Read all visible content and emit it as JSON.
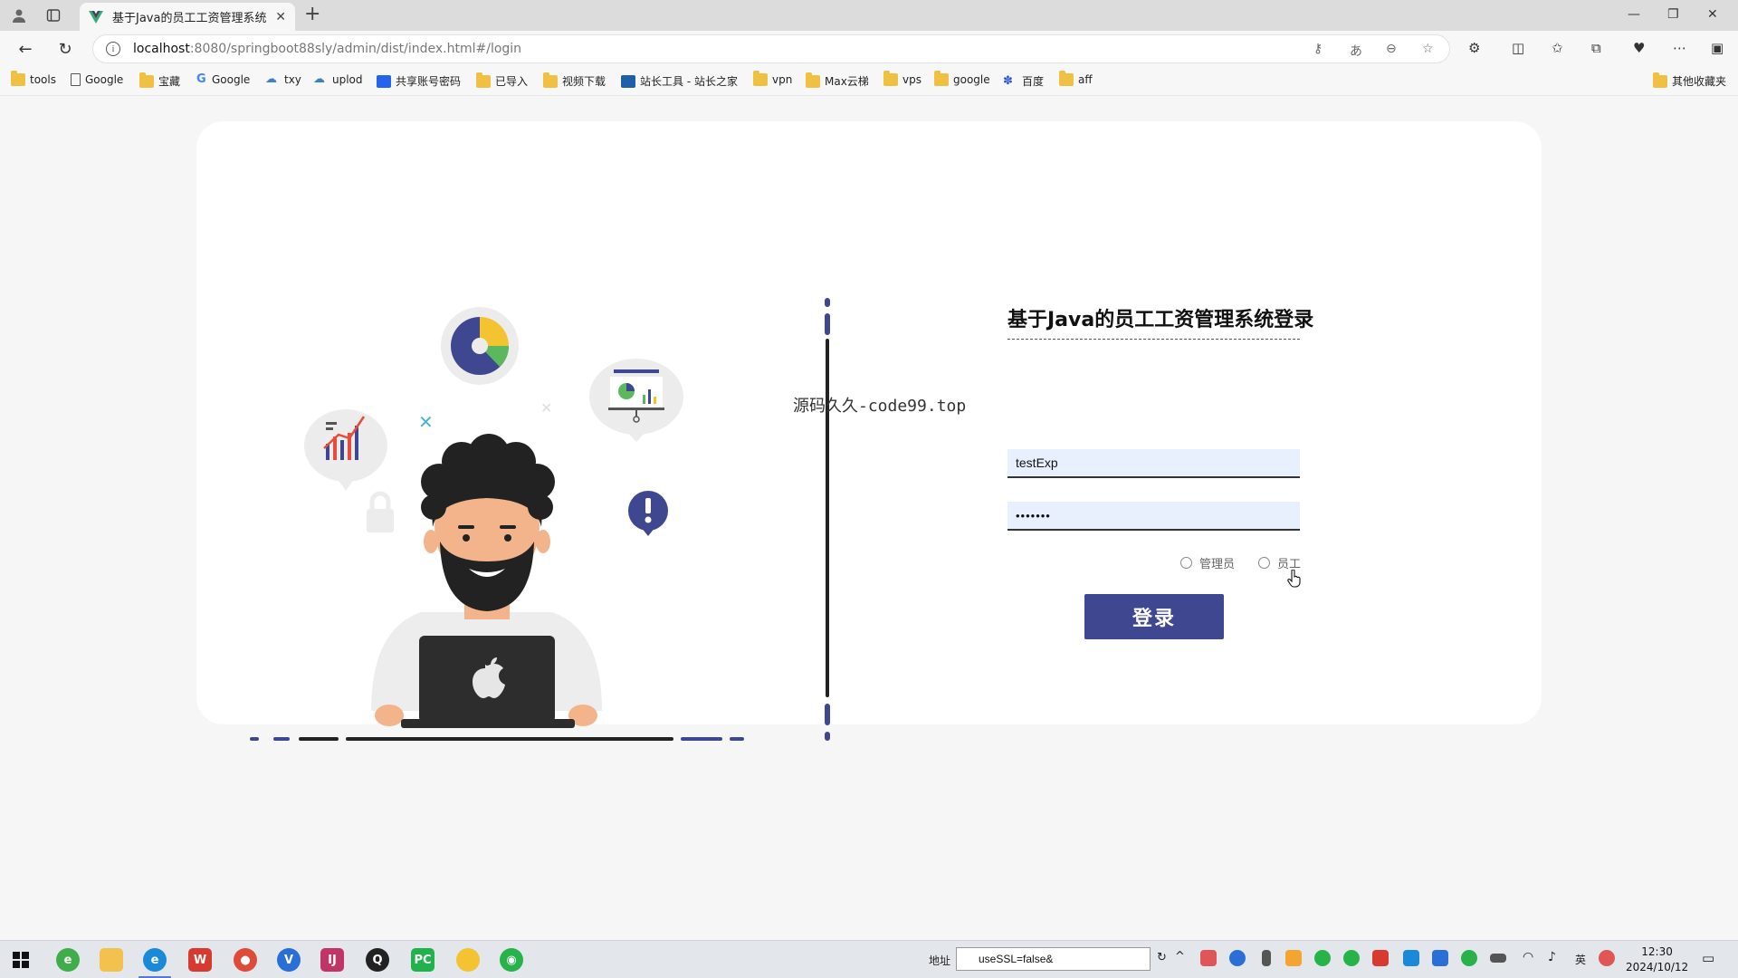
{
  "browser": {
    "tab_title": "基于Java的员工工资管理系统",
    "url_host": "localhost",
    "url_rest": ":8080/springboot88sly/admin/dist/index.html#/login",
    "bookmarks": [
      {
        "label": "tools",
        "icon": "folder"
      },
      {
        "label": "Google",
        "icon": "page"
      },
      {
        "label": "宝藏",
        "icon": "folder"
      },
      {
        "label": "Google",
        "icon": "google"
      },
      {
        "label": "txy",
        "icon": "cloud"
      },
      {
        "label": "uplod",
        "icon": "upload"
      },
      {
        "label": "共享账号密码",
        "icon": "share"
      },
      {
        "label": "已导入",
        "icon": "folder"
      },
      {
        "label": "视频下载",
        "icon": "folder"
      },
      {
        "label": "站长工具 - 站长之家",
        "icon": "tools"
      },
      {
        "label": "vpn",
        "icon": "folder"
      },
      {
        "label": "Max云梯",
        "icon": "folder"
      },
      {
        "label": "vps",
        "icon": "folder"
      },
      {
        "label": "google",
        "icon": "folder"
      },
      {
        "label": "百度",
        "icon": "baidu"
      },
      {
        "label": "aff",
        "icon": "folder"
      }
    ],
    "other_bookmarks": "其他收藏夹"
  },
  "page": {
    "watermark": "源码久久-code99.top",
    "login": {
      "title": "基于Java的员工工资管理系统登录",
      "username_value": "testExp",
      "password_value": "•••••••",
      "roles": [
        {
          "label": "管理员",
          "checked": false
        },
        {
          "label": "员工",
          "checked": false
        }
      ],
      "submit_label": "登录"
    },
    "colors": {
      "primary": "#3f4790",
      "input_bg": "#e8f0fe",
      "card_bg": "#ffffff"
    }
  },
  "taskbar": {
    "address_label": "地址",
    "address_value": "useSSL=false&",
    "ime": "英",
    "time": "12:30",
    "date": "2024/10/12"
  }
}
